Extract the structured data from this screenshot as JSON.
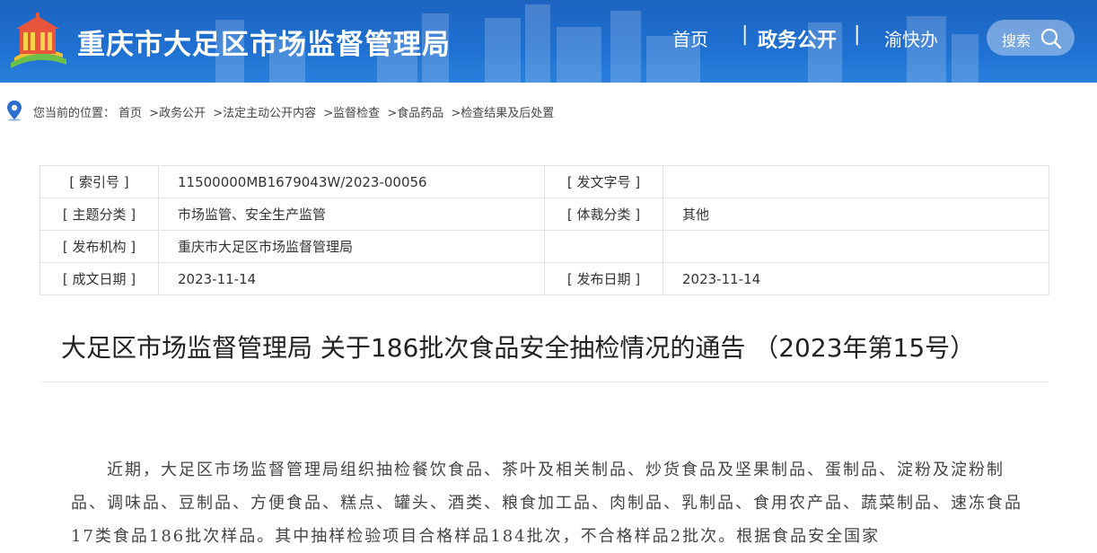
{
  "header": {
    "site_title": "重庆市大足区市场监督管理局",
    "nav": {
      "home": "首页",
      "sep": "|",
      "gov": "政务公开",
      "yu": "渝快办"
    },
    "search_label": "搜索"
  },
  "breadcrumb": {
    "prefix": "您当前的位置：",
    "items": [
      "首页",
      ">政务公开",
      ">法定主动公开内容",
      ">监督检查",
      ">食品药品",
      ">检查结果及后处置"
    ]
  },
  "meta": {
    "rows": [
      {
        "k1": "[ 索引号 ]",
        "v1": "11500000MB1679043W/2023-00056",
        "k2": "[ 发文字号 ]",
        "v2": ""
      },
      {
        "k1": "[ 主题分类 ]",
        "v1": "市场监管、安全生产监管",
        "k2": "[ 体裁分类 ]",
        "v2": "其他"
      },
      {
        "k1": "[ 发布机构 ]",
        "v1": "重庆市大足区市场监督管理局",
        "k2": "",
        "v2": ""
      },
      {
        "k1": "[ 成文日期 ]",
        "v1": "2023-11-14",
        "k2": "[ 发布日期 ]",
        "v2": "2023-11-14"
      }
    ]
  },
  "doc_title": "大足区市场监督管理局 关于186批次食品安全抽检情况的通告 （2023年第15号）",
  "body_text": "近期，大足区市场监督管理局组织抽检餐饮食品、茶叶及相关制品、炒货食品及坚果制品、蛋制品、淀粉及淀粉制品、调味品、豆制品、方便食品、糕点、罐头、酒类、粮食加工品、肉制品、乳制品、食用农产品、蔬菜制品、速冻食品17类食品186批次样品。其中抽样检验项目合格样品184批次，不合格样品2批次。根据食品安全国家"
}
